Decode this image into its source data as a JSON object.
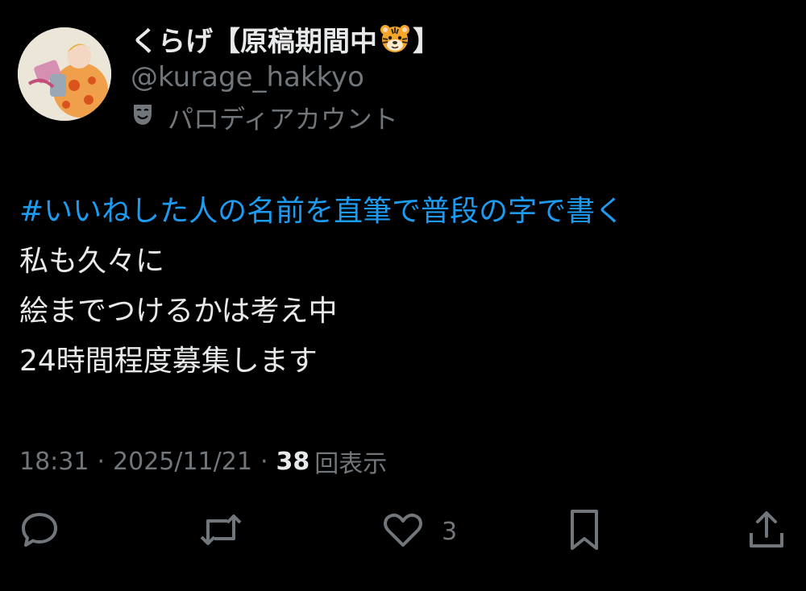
{
  "author": {
    "display_name": "くらげ【原稿期間中",
    "display_name_suffix": "】",
    "name_emoji": "tiger-face",
    "handle": "@kurage_hakkyo",
    "account_label_icon": "theater-mask-icon",
    "account_label": "パロディアカウント"
  },
  "tweet": {
    "hashtag": "#いいねした人の名前を直筆で普段の字で書く",
    "lines": [
      "私も久々に",
      "絵までつけるかは考え中",
      "24時間程度募集します"
    ]
  },
  "meta": {
    "time": "18:31",
    "separator": "·",
    "date": "2025/11/21",
    "views_count": "38",
    "views_label": "回表示"
  },
  "actions": {
    "reply_icon": "speech-bubble-icon",
    "repost_icon": "repost-icon",
    "like_icon": "heart-icon",
    "like_count": "3",
    "bookmark_icon": "bookmark-icon",
    "share_icon": "share-icon"
  },
  "colors": {
    "background": "#000000",
    "text": "#e7e9ea",
    "muted": "#71767b",
    "link": "#1d9bf0"
  }
}
